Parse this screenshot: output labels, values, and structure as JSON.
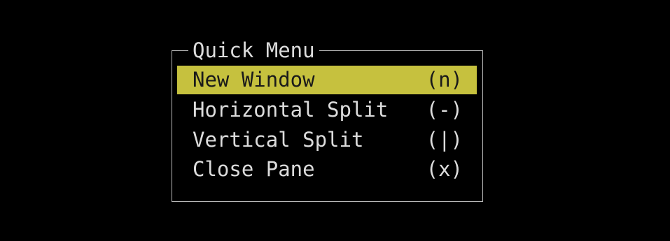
{
  "menu": {
    "title": "Quick Menu",
    "items": [
      {
        "label": "New Window",
        "shortcut": "(n)",
        "selected": true
      },
      {
        "label": "Horizontal Split",
        "shortcut": "(-)",
        "selected": false
      },
      {
        "label": "Vertical Split",
        "shortcut": "(|)",
        "selected": false
      },
      {
        "label": "Close Pane",
        "shortcut": "(x)",
        "selected": false
      }
    ]
  },
  "colors": {
    "background": "#000000",
    "text": "#dcdcdc",
    "highlight": "#c6c13e",
    "highlight_text": "#1a1a1a",
    "border": "#b8b8b8"
  }
}
